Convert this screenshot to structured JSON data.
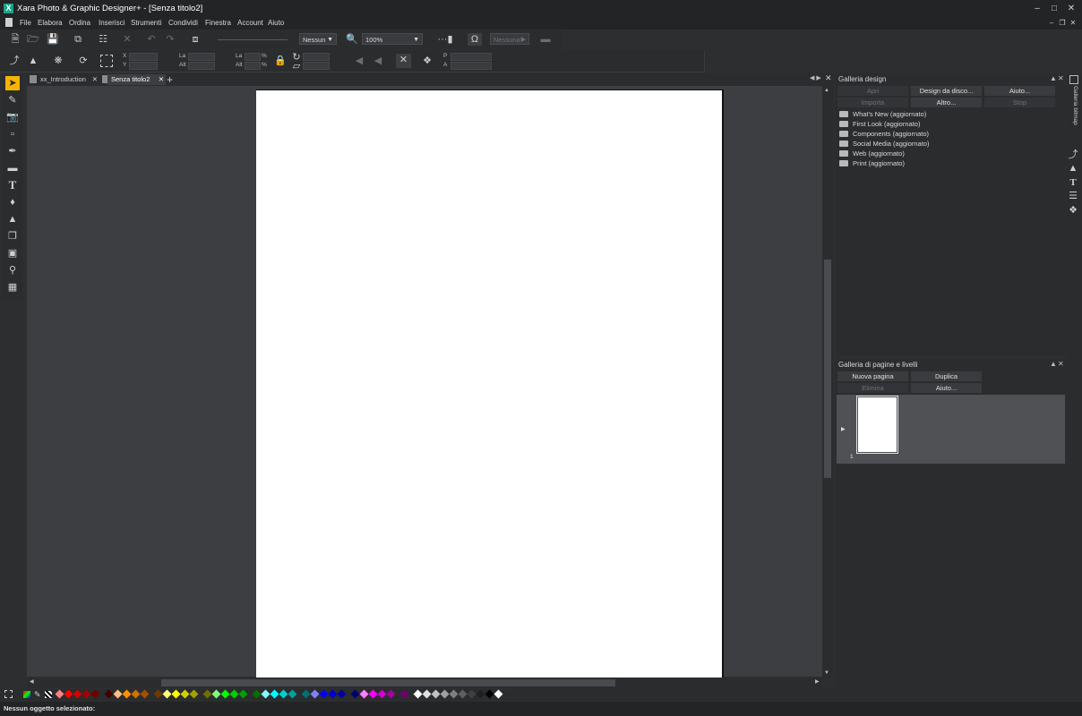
{
  "app": {
    "logo_letter": "X",
    "title": "Xara Photo & Graphic Designer+ - [Senza titolo2]"
  },
  "menu": [
    "File",
    "Elabora",
    "Ordina",
    "Inserisci",
    "Strumenti",
    "Condividi",
    "Finestra",
    "Account",
    "Aiuto"
  ],
  "toolbar1": {
    "blend_dropdown": "Nessun",
    "zoom_dropdown": "100%",
    "none_button": "Nessuna"
  },
  "toolbar2": {
    "x_label": "X",
    "y_label": "Y",
    "width_label": "La",
    "height_label": "Alt",
    "scale_w_label": "La",
    "scale_h_label": "Alt",
    "pct": "%",
    "p_label": "P",
    "a_label": "A"
  },
  "tabs": [
    {
      "label": "xx_Introduction"
    },
    {
      "label": "Senza titolo2"
    }
  ],
  "design_gallery": {
    "title": "Galleria design",
    "buttons": {
      "open": "Apri",
      "design_from_disc": "Design da disco...",
      "help": "Aiuto...",
      "import": "Importa",
      "other": "Altro...",
      "stop": "Stop"
    },
    "folders": [
      "What's New (aggiornato)",
      "First Look (aggiornato)",
      "Components (aggiornato)",
      "Social Media (aggiornato)",
      "Web (aggiornato)",
      "Print (aggiornato)"
    ]
  },
  "pages_gallery": {
    "title": "Galleria di pagine e livelli",
    "buttons": {
      "new_page": "Nuova pagina",
      "duplicate": "Duplica",
      "delete": "Elimina",
      "help": "Aiuto..."
    },
    "page_number": "1"
  },
  "side_tab": "Galleria bitmap",
  "status": "Nessun oggetto selezionato:",
  "colors": {
    "accent": "#f5b400",
    "app_bg": "#2d2e30",
    "canvas": "#3d3e41",
    "page": "#ffffff"
  },
  "palette": [
    "#ff8080",
    "#ff0000",
    "#d00000",
    "#a00000",
    "#700000",
    "#400000",
    "#ffc080",
    "#ff9000",
    "#d07000",
    "#a05000",
    "#703800",
    "#ffff80",
    "#ffff00",
    "#d0d000",
    "#a0a000",
    "#707000",
    "#80ff80",
    "#00ff00",
    "#00d000",
    "#00a000",
    "#007000",
    "#80ffff",
    "#00ffff",
    "#00d0d0",
    "#00a0a0",
    "#007070",
    "#8080ff",
    "#0000ff",
    "#0000d0",
    "#0000a0",
    "#000070",
    "#ff80ff",
    "#ff00ff",
    "#d000d0",
    "#a000a0",
    "#700070",
    "#ffffff",
    "#e0e0e0",
    "#c0c0c0",
    "#a0a0a0",
    "#808080",
    "#606060",
    "#404040",
    "#202020",
    "#000000",
    "#ffffff"
  ]
}
